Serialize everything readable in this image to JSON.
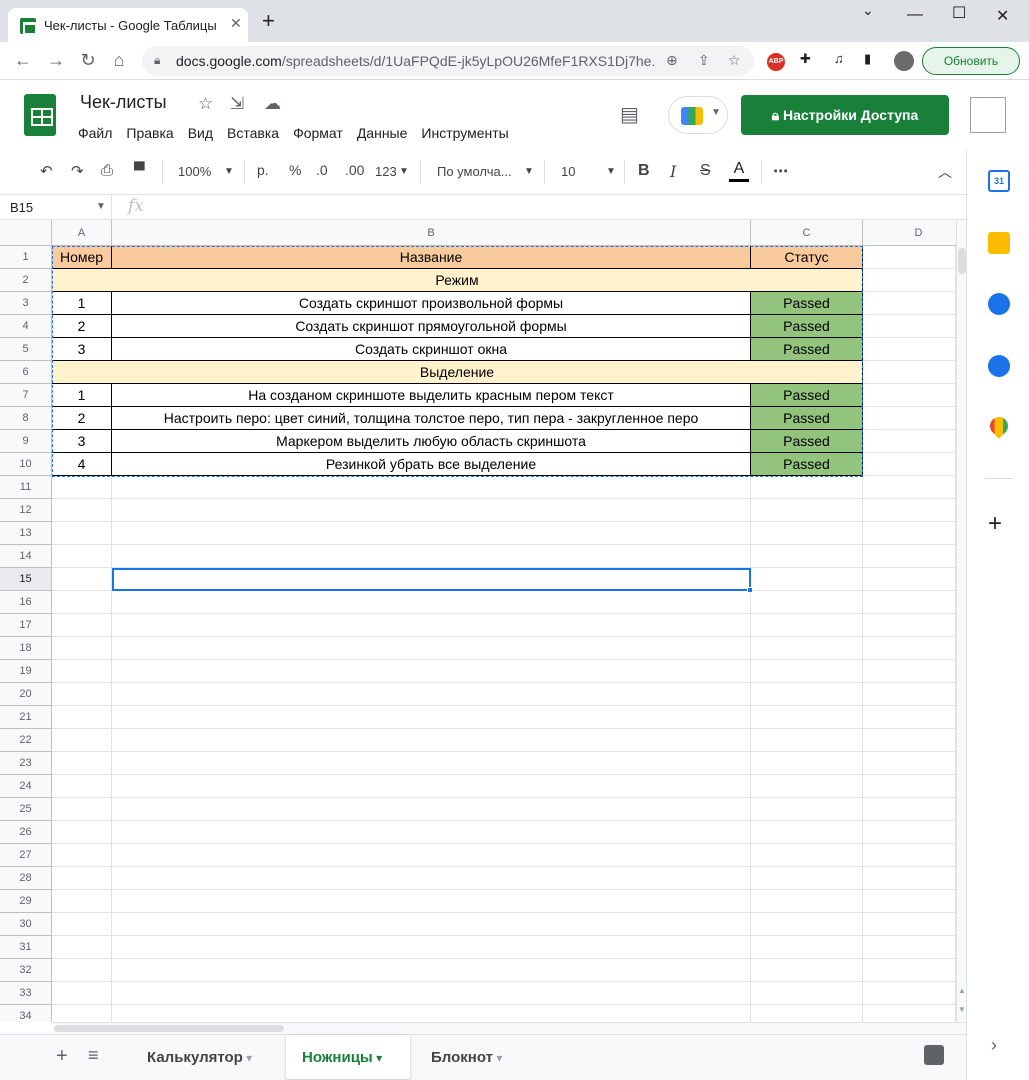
{
  "browser": {
    "tab_title": "Чек-листы - Google Таблицы",
    "url_host": "docs.google.com",
    "url_path": "/spreadsheets/d/1UaFPQdE-jk5yLpOU26MfeF1RXS1Dj7he...",
    "update_label": "Обновить",
    "abp_label": "ABP"
  },
  "doc": {
    "title": "Чек-листы",
    "menu": [
      "Файл",
      "Правка",
      "Вид",
      "Вставка",
      "Формат",
      "Данные",
      "Инструменты"
    ],
    "share_label": "Настройки Доступа"
  },
  "toolbar": {
    "zoom": "100%",
    "currency": "р.",
    "percent": "%",
    "dec_less": ".0",
    "dec_more": ".00",
    "format_more": "123",
    "font": "По умолча...",
    "font_size": "10"
  },
  "formula_bar": {
    "name_box": "B15",
    "fx": "fx"
  },
  "columns": [
    "A",
    "B",
    "C",
    "D"
  ],
  "rows": [
    {
      "n": "1",
      "type": "header",
      "a": "Номер",
      "b": "Название",
      "c": "Статус"
    },
    {
      "n": "2",
      "type": "section",
      "b": "Режим"
    },
    {
      "n": "3",
      "type": "item",
      "a": "1",
      "b": "Создать скриншот произвольной формы",
      "c": "Passed"
    },
    {
      "n": "4",
      "type": "item",
      "a": "2",
      "b": "Создать скриншот прямоугольной формы",
      "c": "Passed"
    },
    {
      "n": "5",
      "type": "item",
      "a": "3",
      "b": "Создать скриншот окна",
      "c": "Passed"
    },
    {
      "n": "6",
      "type": "section",
      "b": "Выделение"
    },
    {
      "n": "7",
      "type": "item",
      "a": "1",
      "b": "На созданом скриншоте выделить красным пером текст",
      "c": "Passed"
    },
    {
      "n": "8",
      "type": "item",
      "a": "2",
      "b": "Настроить перо: цвет синий, толщина толстое перо, тип пера - закругленное перо",
      "c": "Passed"
    },
    {
      "n": "9",
      "type": "item",
      "a": "3",
      "b": "Маркером выделить любую область скриншота",
      "c": "Passed"
    },
    {
      "n": "10",
      "type": "item",
      "a": "4",
      "b": "Резинкой убрать все выделение",
      "c": "Passed"
    }
  ],
  "empty_rows": [
    "11",
    "12",
    "13",
    "14",
    "15",
    "16",
    "17",
    "18",
    "19",
    "20",
    "21",
    "22",
    "23",
    "24",
    "25",
    "26",
    "27",
    "28",
    "29",
    "30",
    "31",
    "32",
    "33",
    "34"
  ],
  "selected_row": "15",
  "sheets": [
    {
      "name": "Калькулятор",
      "active": false
    },
    {
      "name": "Ножницы",
      "active": true
    },
    {
      "name": "Блокнот",
      "active": false
    }
  ],
  "side_panel": {
    "calendar_day": "31"
  },
  "colors": {
    "header": "#f9cb9c",
    "section": "#fff2cc",
    "passed": "#93c47d",
    "accent": "#188038",
    "selection": "#1a73e8"
  }
}
